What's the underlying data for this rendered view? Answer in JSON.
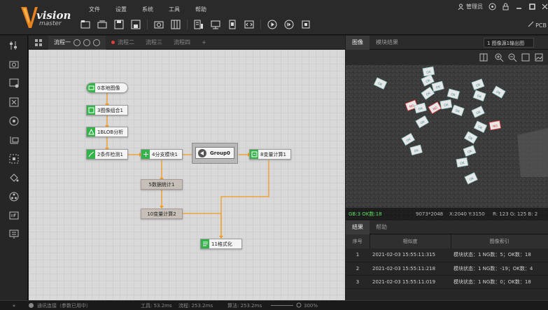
{
  "menu": [
    "文件",
    "设置",
    "系统",
    "工具",
    "帮助"
  ],
  "logo": {
    "word": "vision",
    "sub": "master"
  },
  "user": {
    "label": "管理员"
  },
  "pcb": "PCB",
  "flow_tabs": [
    {
      "label": "流程一",
      "active": true
    },
    {
      "label": "流程二",
      "active": false
    },
    {
      "label": "流程三",
      "active": false
    },
    {
      "label": "流程四",
      "active": false
    },
    {
      "label": "+",
      "active": false
    }
  ],
  "nodes": {
    "n0": "0本地图像",
    "n3": "3图像组合1",
    "n1": "1BLOB分析",
    "n2": "2条件检测1",
    "n4": "4分支模块1",
    "group": "Group0",
    "n8": "8变量计算1",
    "n5": "5数据统计1",
    "n10": "10变量计算2",
    "n11": "11格式化"
  },
  "image_tabs": [
    {
      "label": "图像",
      "active": true
    },
    {
      "label": "模块结果",
      "active": false
    }
  ],
  "image_select": "1 图像源1输出图",
  "ok_label": "OK",
  "ng_label": "NG",
  "image_status": {
    "left": "GB:3 OK数:18",
    "size": "9073*2048",
    "coords": "X:2040  Y:3150",
    "rgb": "R: 123  G: 125  B: 2"
  },
  "result_tabs": [
    {
      "label": "结果",
      "active": true
    },
    {
      "label": "帮助",
      "active": false
    }
  ],
  "result_table": {
    "headers": [
      "序号",
      "相似度",
      "图像索引"
    ],
    "rows": [
      {
        "idx": "1",
        "time": "2021-02-03 15:55:11:315",
        "info": "模块状态：1  NG数：5；OK数：18"
      },
      {
        "idx": "2",
        "time": "2021-02-03 15:55:11:218",
        "info": "模块状态：1  NG数：-19；OK数：4"
      },
      {
        "idx": "3",
        "time": "2021-02-03 15:55:11:019",
        "info": "模块状态：1  NG数：0；OK数：18"
      }
    ]
  },
  "statusbar": {
    "left": "通讯连接（参数已用中）",
    "tool": "工具: 53.2ms",
    "flow": "流程: 253.2ms",
    "total": "算法: 253.2ms",
    "zoom": "300%"
  },
  "colors": {
    "accent_green": "#34b34a",
    "flow_line": "#f29a1e",
    "ng_red": "#e03030"
  }
}
